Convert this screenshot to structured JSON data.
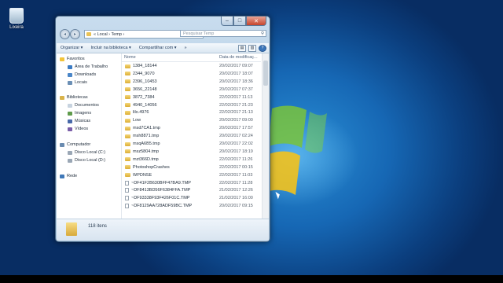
{
  "desktop": {
    "recycle_label": "Lixeira"
  },
  "window": {
    "breadcrumb": "« Local › Temp ›",
    "search_placeholder": "Pesquisar Temp",
    "controls": {
      "minimize": "‒",
      "maximize": "□",
      "close": "✕"
    },
    "back_icon": "◂",
    "forward_icon": "▸",
    "dropdown": "▾",
    "refresh": "↻",
    "mag": "⚲"
  },
  "toolbar": {
    "organize": "Organizar ▾",
    "include": "Incluir na biblioteca ▾",
    "share": "Compartilhar com ▾",
    "more": "»",
    "help": "?"
  },
  "nav": {
    "favorites": "Favoritos",
    "desktop": "Área de Trabalho",
    "downloads": "Downloads",
    "locals": "Locais",
    "libraries": "Bibliotecas",
    "documents": "Documentos",
    "images": "Imagens",
    "music": "Músicas",
    "videos": "Vídeos",
    "computer": "Computador",
    "disk_c": "Disco Local (C:)",
    "disk_d": "Disco Local (D:)",
    "network": "Rede"
  },
  "columns": {
    "name": "Nome",
    "date": "Data de modificaç..."
  },
  "files": [
    {
      "name": "1384_18144",
      "date": "20/02/2017 09:07",
      "type": "folder"
    },
    {
      "name": "2344_9070",
      "date": "20/02/2017 18:07",
      "type": "folder"
    },
    {
      "name": "2396_10453",
      "date": "20/02/2017 18:36",
      "type": "folder"
    },
    {
      "name": "3656_22148",
      "date": "20/02/2017 07:37",
      "type": "folder"
    },
    {
      "name": "3872_7384",
      "date": "22/02/2017 11:13",
      "type": "folder"
    },
    {
      "name": "4940_14056",
      "date": "22/02/2017 21:23",
      "type": "folder"
    },
    {
      "name": "lilo.4976",
      "date": "22/02/2017 21:13",
      "type": "folder"
    },
    {
      "name": "Low",
      "date": "20/02/2017 09:00",
      "type": "folder"
    },
    {
      "name": "msd7CA1.tmp",
      "date": "20/02/2017 17:57",
      "type": "folder"
    },
    {
      "name": "msh8871.tmp",
      "date": "20/02/2017 02:24",
      "type": "folder"
    },
    {
      "name": "msqA6B5.tmp",
      "date": "20/02/2017 22:02",
      "type": "folder"
    },
    {
      "name": "msz5804.tmp",
      "date": "20/02/2017 18:19",
      "type": "folder"
    },
    {
      "name": "mzt366D.tmp",
      "date": "22/02/2017 11:26",
      "type": "folder"
    },
    {
      "name": "PhotoshopCrashes",
      "date": "22/02/2017 00:15",
      "type": "folder"
    },
    {
      "name": "WPDNSE",
      "date": "22/02/2017 11:03",
      "type": "folder"
    },
    {
      "name": "~DF41F2B630BFF47BA9.TMP",
      "date": "22/02/2017 11:28",
      "type": "file"
    },
    {
      "name": "~DF8413BD56F6384FFA.TMP",
      "date": "21/02/2017 12:26",
      "type": "file"
    },
    {
      "name": "~DF93338F93F426F01C.TMP",
      "date": "21/02/2017 16:00",
      "type": "file"
    },
    {
      "name": "~DF8129AA728ADF59BC.TMP",
      "date": "20/02/2017 09:15",
      "type": "file"
    }
  ],
  "details": {
    "count": "118 itens"
  }
}
